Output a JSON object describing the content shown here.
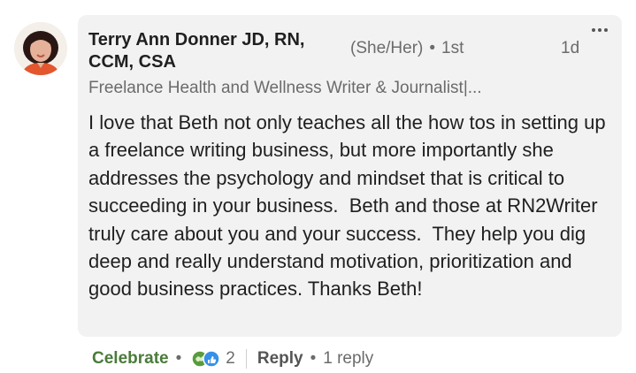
{
  "author": {
    "name": "Terry Ann Donner JD, RN, CCM, CSA",
    "pronouns": "(She/Her)",
    "separator": "•",
    "degree": "1st",
    "headline": "Freelance Health and Wellness Writer & Journalist|..."
  },
  "timestamp": "1d",
  "body": "I love that Beth not only teaches all the how tos in setting up a freelance writing business, but more importantly she addresses the psychology and mindset that is critical to succeeding in your business.  Beth and those at RN2Writer truly care about you and your success.  They help you dig deep and really understand motivation, prioritization and good business practices. Thanks Beth!",
  "actions": {
    "celebrate_label": "Celebrate",
    "separator": "•",
    "reaction_count": "2",
    "reaction_icons": [
      "celebrate-icon",
      "like-icon"
    ],
    "reply_label": "Reply",
    "replies_label": "1 reply"
  },
  "colors": {
    "bubble": "#f2f2f2",
    "celebrate_green": "#4a7b3a",
    "like_blue": "#378fe9",
    "muted_text": "#6b6b6b",
    "avatar_shirt": "#e2572e"
  }
}
